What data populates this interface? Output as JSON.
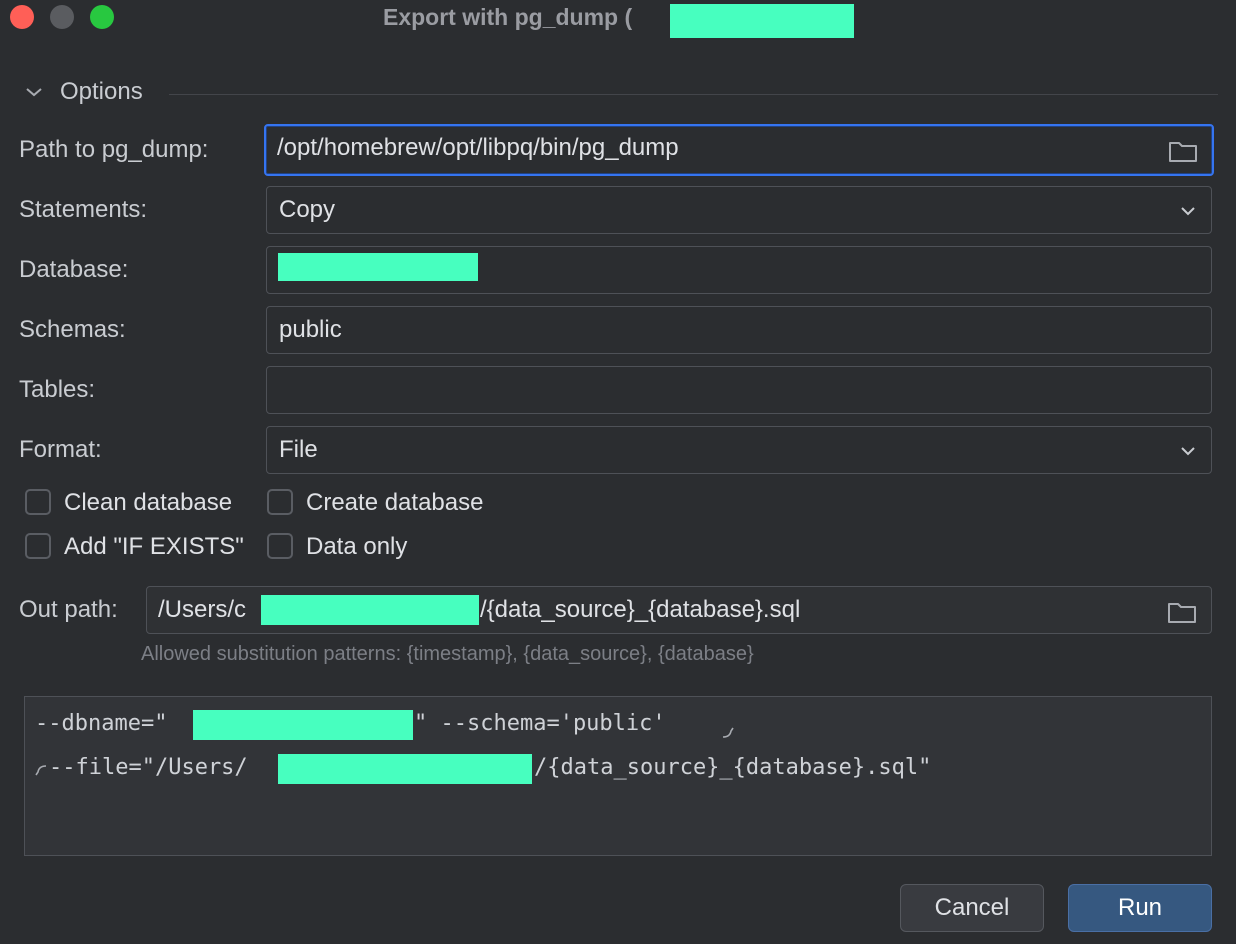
{
  "window": {
    "title": "Export with pg_dump (",
    "title_suffix_redacted": true
  },
  "options": {
    "section_label": "Options"
  },
  "form": {
    "path_label": "Path to pg_dump:",
    "path_value": "/opt/homebrew/opt/libpq/bin/pg_dump",
    "statements_label": "Statements:",
    "statements_value": "Copy",
    "database_label": "Database:",
    "database_value": "",
    "schemas_label": "Schemas:",
    "schemas_value": "public",
    "tables_label": "Tables:",
    "tables_value": "",
    "format_label": "Format:",
    "format_value": "File"
  },
  "checkboxes": {
    "clean_database": {
      "label": "Clean database",
      "checked": false
    },
    "create_database": {
      "label": "Create database",
      "checked": false
    },
    "add_if_exists": {
      "label": "Add \"IF EXISTS\"",
      "checked": false
    },
    "data_only": {
      "label": "Data only",
      "checked": false
    }
  },
  "out": {
    "label": "Out path:",
    "value_prefix": "/Users/c",
    "value_suffix": "/{data_source}_{database}.sql",
    "hint": "Allowed substitution patterns: {timestamp}, {data_source}, {database}"
  },
  "command": {
    "line1_a": "--dbname=\"",
    "line1_b": "\" --schema='public'",
    "line2_a": "--file=\"/Users/",
    "line2_b": "/{data_source}_{database}.sql\""
  },
  "buttons": {
    "cancel": "Cancel",
    "run": "Run"
  },
  "colors": {
    "background": "#2b2d30",
    "accent": "#3574f0",
    "primary_button": "#365880",
    "redaction": "#47ffbf"
  },
  "icons": [
    "chevron-down-icon",
    "folder-icon",
    "dropdown-arrow-icon",
    "soft-wrap-icon"
  ]
}
